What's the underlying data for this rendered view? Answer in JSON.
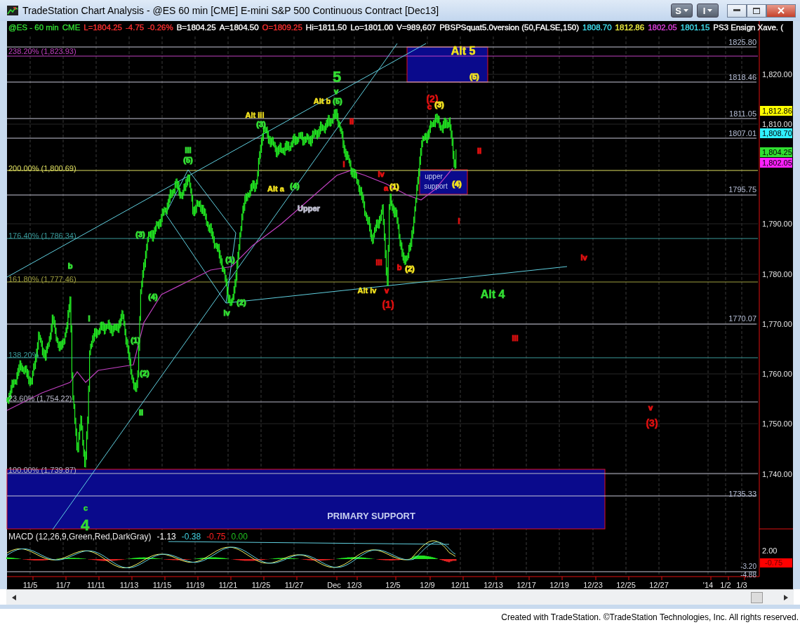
{
  "window": {
    "title": "TradeStation Chart Analysis - @ES 60 min [CME] E-mini S&P 500 Continuous Contract [Dec13]",
    "menu_buttons": [
      "S",
      "I"
    ]
  },
  "chart": {
    "info_line": [
      {
        "text": "@ES - 60 min",
        "color": "#33dd33"
      },
      {
        "text": "CME",
        "color": "#33dd33"
      },
      {
        "text": "L=1804.25",
        "color": "#ff3030"
      },
      {
        "text": "-4.75",
        "color": "#ff3030"
      },
      {
        "text": "-0.26%",
        "color": "#ff3030"
      },
      {
        "text": "B=1804.25",
        "color": "#ffffff"
      },
      {
        "text": "A=1804.50",
        "color": "#ffffff"
      },
      {
        "text": "O=1809.25",
        "color": "#ff3030"
      },
      {
        "text": "Hi=1811.50",
        "color": "#ffffff"
      },
      {
        "text": "Lo=1801.00",
        "color": "#ffffff"
      },
      {
        "text": "V=989,607",
        "color": "#ffffff"
      },
      {
        "text": "PBSPSquat5.0version (50,FALSE,150)",
        "color": "#ffffff"
      },
      {
        "text": "1808.70",
        "color": "#40e0f0"
      },
      {
        "text": "1812.86",
        "color": "#f0f040"
      },
      {
        "text": "1802.05",
        "color": "#e040e0"
      },
      {
        "text": "1801.15",
        "color": "#40e0f0"
      },
      {
        "text": "PS3 Ensign Xave. (",
        "color": "#ffffff"
      }
    ],
    "fib_levels": [
      {
        "text": "238.20% (1,823.93)",
        "color": "#c040c0"
      },
      {
        "text": "200.00% (1,800.69)",
        "color": "#e0e060"
      },
      {
        "text": "176.40% (1,786.34)",
        "color": "#3a9a9a"
      },
      {
        "text": "161.80% (1,777.46)",
        "color": "#a0a040"
      },
      {
        "text": "138.20%",
        "color": "#3a9a9a"
      },
      {
        "text": "23.60% (1,754.22)",
        "color": "#b8b8c8"
      },
      {
        "text": "100.00% (1,739.87)",
        "color": "#b8b8c8"
      }
    ],
    "levels": [
      "1825.80",
      "1818.46",
      "1811.05",
      "1807.01",
      "1795.75",
      "1770.07",
      "1735.33"
    ],
    "price_axis": [
      "1,820.00",
      "1,810.00",
      "1,790.00",
      "1,780.00",
      "1,770.00",
      "1,760.00",
      "1,750.00",
      "1,740.00"
    ],
    "price_badges": [
      {
        "text": "1,812.86",
        "color": "#ffff00"
      },
      {
        "text": "1,808.70",
        "color": "#30f0ff"
      },
      {
        "text": "1,804.25",
        "color": "#30e030"
      },
      {
        "text": "1,802.05",
        "color": "#ff20ff"
      }
    ],
    "wave_labels": [
      {
        "text": "Alt 5",
        "color": "#f0e020",
        "kind": "title"
      },
      {
        "text": "(5)",
        "color": "#f0e020",
        "kind": "small"
      },
      {
        "text": "5",
        "color": "#33dd33",
        "kind": "big"
      },
      {
        "text": "v",
        "color": "#33dd33",
        "kind": "small"
      },
      {
        "text": "Alt b",
        "color": "#f0e020",
        "kind": "alt"
      },
      {
        "text": "(5)",
        "color": "#33dd33",
        "kind": "small"
      },
      {
        "text": "Alt iii",
        "color": "#f0e020",
        "kind": "alt"
      },
      {
        "text": "(3)",
        "color": "#33dd33",
        "kind": "small"
      },
      {
        "text": "ii",
        "color": "#e01010",
        "kind": "small"
      },
      {
        "text": "(2)",
        "color": "#e01010",
        "kind": "wave"
      },
      {
        "text": "c",
        "color": "#e01010",
        "kind": "small"
      },
      {
        "text": "(3)",
        "color": "#f0e020",
        "kind": "small"
      },
      {
        "text": "iii",
        "color": "#33dd33",
        "kind": "small"
      },
      {
        "text": "(5)",
        "color": "#33dd33",
        "kind": "small"
      },
      {
        "text": "ii",
        "color": "#e01010",
        "kind": "small"
      },
      {
        "text": "i",
        "color": "#e01010",
        "kind": "small"
      },
      {
        "text": "iv",
        "color": "#e01010",
        "kind": "small"
      },
      {
        "text": "(4)",
        "color": "#f0e020",
        "kind": "small"
      },
      {
        "text": "Alt a",
        "color": "#f0e020",
        "kind": "alt"
      },
      {
        "text": "(4)",
        "color": "#33dd33",
        "kind": "small"
      },
      {
        "text": "a",
        "color": "#e01010",
        "kind": "small"
      },
      {
        "text": "(1)",
        "color": "#f0e020",
        "kind": "small"
      },
      {
        "text": "Upper",
        "color": "#b8b8c8",
        "kind": "small"
      },
      {
        "text": "i",
        "color": "#e01010",
        "kind": "small"
      },
      {
        "text": "(3)",
        "color": "#33dd33",
        "kind": "small"
      },
      {
        "text": "(1)",
        "color": "#33dd33",
        "kind": "small"
      },
      {
        "text": "iv",
        "color": "#e01010",
        "kind": "small"
      },
      {
        "text": "iii",
        "color": "#e01010",
        "kind": "small"
      },
      {
        "text": "b",
        "color": "#e01010",
        "kind": "small"
      },
      {
        "text": "(2)",
        "color": "#f0e020",
        "kind": "small"
      },
      {
        "text": "b",
        "color": "#33dd33",
        "kind": "small"
      },
      {
        "text": "Alt iv",
        "color": "#f0e020",
        "kind": "alt"
      },
      {
        "text": "v",
        "color": "#e01010",
        "kind": "small"
      },
      {
        "text": "Alt 4",
        "color": "#33dd33",
        "kind": "title"
      },
      {
        "text": "(4)",
        "color": "#33dd33",
        "kind": "small"
      },
      {
        "text": "(1)",
        "color": "#e01010",
        "kind": "wave"
      },
      {
        "text": "(2)",
        "color": "#33dd33",
        "kind": "small"
      },
      {
        "text": "iv",
        "color": "#33dd33",
        "kind": "small"
      },
      {
        "text": "i",
        "color": "#33dd33",
        "kind": "small"
      },
      {
        "text": "iii",
        "color": "#e01010",
        "kind": "small"
      },
      {
        "text": "(1)",
        "color": "#33dd33",
        "kind": "small"
      },
      {
        "text": "(2)",
        "color": "#33dd33",
        "kind": "small"
      },
      {
        "text": "v",
        "color": "#e01010",
        "kind": "small"
      },
      {
        "text": "(3)",
        "color": "#e01010",
        "kind": "wave"
      },
      {
        "text": "ii",
        "color": "#33dd33",
        "kind": "small"
      },
      {
        "text": "c",
        "color": "#33dd33",
        "kind": "alt"
      },
      {
        "text": "4",
        "color": "#33dd33",
        "kind": "big"
      }
    ],
    "zone_labels": [
      "upper",
      "support",
      "PRIMARY SUPPORT"
    ],
    "macd": {
      "title": "MACD (12,26,9,Green,Red,DarkGray)",
      "values": [
        {
          "text": "-1.13",
          "color": "#ffffff"
        },
        {
          "text": "-0.38",
          "color": "#40d0e0"
        },
        {
          "text": "-0.75",
          "color": "#ff2020"
        },
        {
          "text": "0.00",
          "color": "#20c020"
        }
      ],
      "axis": [
        "2.00"
      ],
      "badge": {
        "text": "-0.75",
        "color": "#ff0000"
      },
      "levels": [
        "-3.20",
        "-4.88"
      ]
    },
    "date_axis": [
      "11/5",
      "11/7",
      "11/11",
      "11/13",
      "11/15",
      "11/19",
      "11/21",
      "11/25",
      "11/27",
      "Dec",
      "12/3",
      "12/5",
      "12/9",
      "12/11",
      "12/13",
      "12/17",
      "12/19",
      "12/23",
      "12/25",
      "12/27",
      "'14",
      "1/2",
      "1/3"
    ]
  },
  "footer": "Created with TradeStation. ©TradeStation Technologies, Inc. All rights reserved."
}
